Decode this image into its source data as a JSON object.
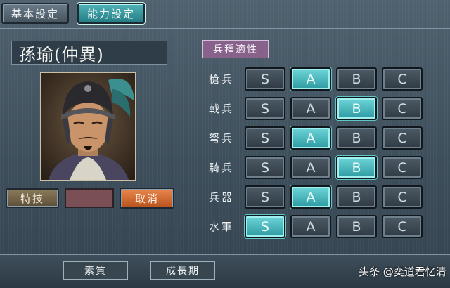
{
  "tabs": {
    "basic": "基本設定",
    "ability": "能力設定"
  },
  "character": {
    "name": "孫瑜(仲異)"
  },
  "skill": {
    "label": "特技",
    "cancel": "取消"
  },
  "aptitude": {
    "title": "兵種適性",
    "grades": [
      "S",
      "A",
      "B",
      "C"
    ],
    "rows": [
      {
        "label": "槍兵",
        "selected": "A"
      },
      {
        "label": "戟兵",
        "selected": "B"
      },
      {
        "label": "弩兵",
        "selected": "A"
      },
      {
        "label": "騎兵",
        "selected": "B"
      },
      {
        "label": "兵器",
        "selected": "A"
      },
      {
        "label": "水軍",
        "selected": "S"
      }
    ]
  },
  "bottom": {
    "quality": "素質",
    "growth": "成長期"
  },
  "watermark": "头条 @奕道君忆清"
}
